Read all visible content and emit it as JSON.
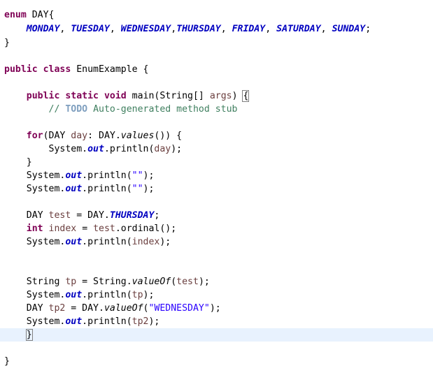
{
  "code": {
    "l1": {
      "kw_enum": "enum",
      "t1": " DAY{"
    },
    "l2": {
      "indent": "    ",
      "monday": "MONDAY",
      "sep1": ", ",
      "tuesday": "TUESDAY",
      "sep2": ", ",
      "wednesday": "WEDNESDAY",
      "sep3": ",",
      "thursday": "THURSDAY",
      "sep4": ", ",
      "friday": "FRIDAY",
      "sep5": ", ",
      "saturday": "SATURDAY",
      "sep6": ", ",
      "sunday": "SUNDAY",
      "end": ";"
    },
    "l3": {
      "t": "}"
    },
    "l5": {
      "kw_public": "public",
      "sp": " ",
      "kw_class": "class",
      "t": " EnumExample {"
    },
    "l7": {
      "indent": "    ",
      "kw_public": "public",
      "sp1": " ",
      "kw_static": "static",
      "sp2": " ",
      "kw_void": "void",
      "t1": " main(String[] ",
      "args": "args",
      "t2": ") ",
      "brace": "{"
    },
    "l8": {
      "indent": "        ",
      "slashes": "// ",
      "todo": "TODO",
      "rest": " Auto-generated method stub"
    },
    "l10": {
      "indent": "    ",
      "kw_for": "for",
      "t1": "(DAY ",
      "day": "day",
      "t2": ": DAY.",
      "values": "values",
      "t3": "()) {"
    },
    "l11": {
      "indent": "        ",
      "t1": "System.",
      "out": "out",
      "t2": ".println(",
      "day": "day",
      "t3": ");"
    },
    "l12": {
      "indent": "    ",
      "t": "}"
    },
    "l13": {
      "indent": "    ",
      "t1": "System.",
      "out": "out",
      "t2": ".println(",
      "s": "\"\"",
      "t3": ");"
    },
    "l14": {
      "indent": "    ",
      "t1": "System.",
      "out": "out",
      "t2": ".println(",
      "s": "\"\"",
      "t3": ");"
    },
    "l16": {
      "indent": "    ",
      "t1": "DAY ",
      "test": "test",
      "t2": " = DAY.",
      "thursday": "THURSDAY",
      "t3": ";"
    },
    "l17": {
      "indent": "    ",
      "kw_int": "int",
      "sp": " ",
      "index": "index",
      "t1": " = ",
      "test": "test",
      "t2": ".ordinal();"
    },
    "l18": {
      "indent": "    ",
      "t1": "System.",
      "out": "out",
      "t2": ".println(",
      "index": "index",
      "t3": ");"
    },
    "l21": {
      "indent": "    ",
      "t1": "String ",
      "tp": "tp",
      "t2": " = String.",
      "valueof": "valueOf",
      "t3": "(",
      "test": "test",
      "t4": ");"
    },
    "l22": {
      "indent": "    ",
      "t1": "System.",
      "out": "out",
      "t2": ".println(",
      "tp": "tp",
      "t3": ");"
    },
    "l23": {
      "indent": "    ",
      "t1": "DAY ",
      "tp2": "tp2",
      "t2": " = DAY.",
      "valueof": "valueOf",
      "t3": "(",
      "s": "\"WEDNESDAY\"",
      "t4": ");"
    },
    "l24": {
      "indent": "    ",
      "t1": "System.",
      "out": "out",
      "t2": ".println(",
      "tp2": "tp2",
      "t3": ");"
    },
    "l25": {
      "indent": "    ",
      "t": "}"
    },
    "l27": {
      "t": "}"
    }
  }
}
